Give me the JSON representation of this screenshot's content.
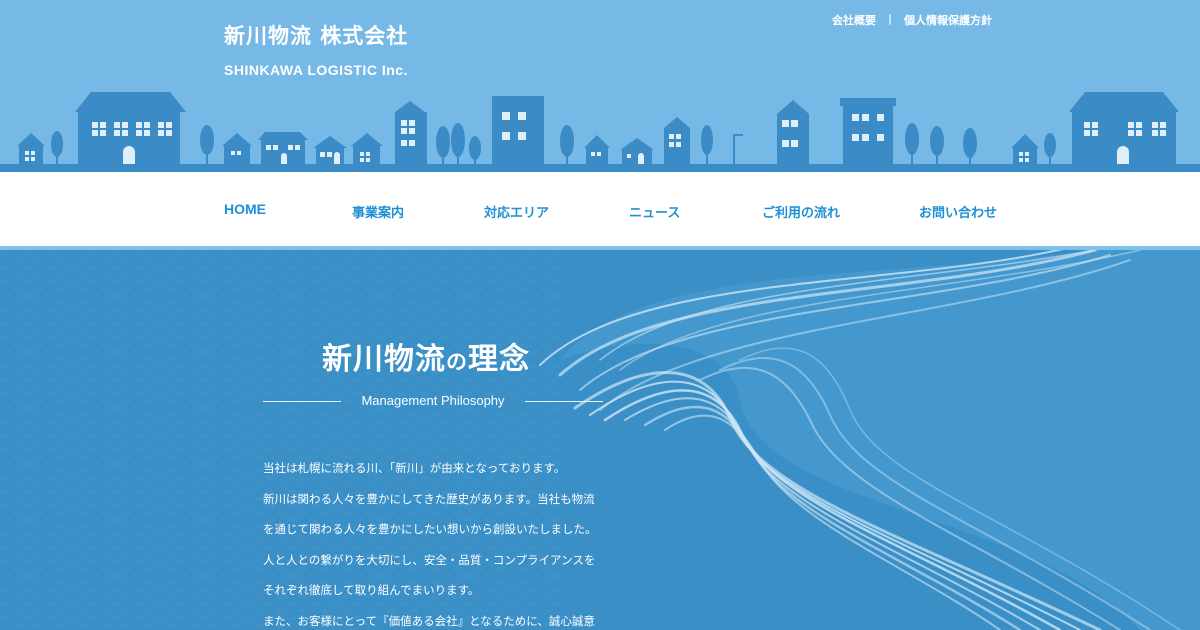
{
  "header": {
    "company_name_jp": "新川物流 株式会社",
    "company_name_en": "SHINKAWA LOGISTIC Inc.",
    "util_links": [
      "会社概要",
      "個人情報保護方針"
    ],
    "util_separator": "|"
  },
  "nav": {
    "items": [
      "HOME",
      "事業案内",
      "対応エリア",
      "ニュース",
      "ご利用の流れ",
      "お問い合わせ"
    ]
  },
  "hero": {
    "title_main": "新川物流",
    "title_particle": "の",
    "title_end": "理念",
    "subtitle": "Management Philosophy",
    "paragraphs": [
      "当社は札幌に流れる川、「新川」が由来となっております。",
      "新川は関わる人々を豊かにしてきた歴史があります。当社も物流",
      "を通じて関わる人々を豊かにしたい想いから創設いたしました。",
      "人と人との繋がりを大切にし、安全・品質・コンプライアンスを",
      "それぞれ徹底して取り組んでまいります。",
      "また、お客様にとって『価値ある会社』となるために、誠心誠意"
    ]
  },
  "colors": {
    "sky": "#76b9e7",
    "building": "#3a8bc6",
    "nav_text": "#1f8fd6",
    "hero_bg": "#3a8fc6"
  }
}
